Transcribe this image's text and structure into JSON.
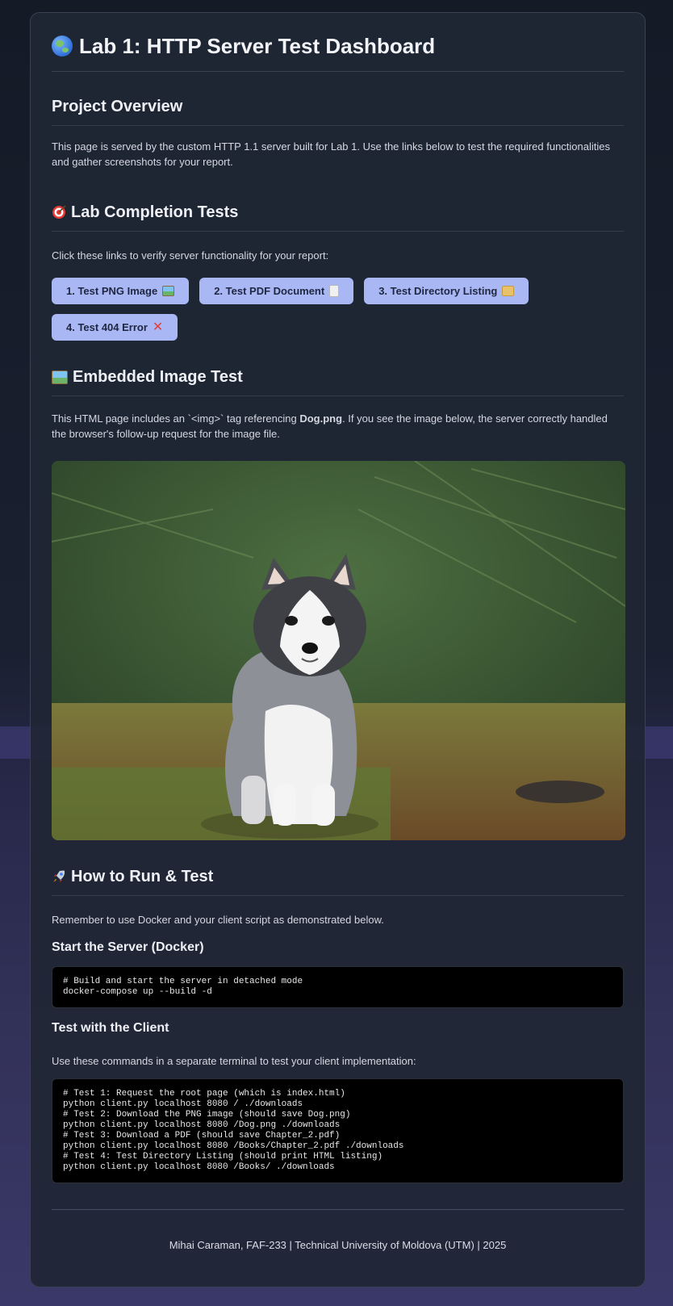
{
  "header": {
    "title": "Lab 1: HTTP Server Test Dashboard",
    "icon": "globe-icon"
  },
  "overview": {
    "heading": "Project Overview",
    "text": "This page is served by the custom HTTP 1.1 server built for Lab 1. Use the links below to test the required functionalities and gather screenshots for your report."
  },
  "tests": {
    "heading": "Lab Completion Tests",
    "icon": "target-icon",
    "intro": "Click these links to verify server functionality for your report:",
    "buttons": [
      {
        "label": "1. Test PNG Image",
        "icon": "image-icon"
      },
      {
        "label": "2. Test PDF Document",
        "icon": "document-icon"
      },
      {
        "label": "3. Test Directory Listing",
        "icon": "folder-icon"
      },
      {
        "label": "4. Test 404 Error",
        "icon": "x-icon"
      }
    ]
  },
  "embed": {
    "heading": "Embedded Image Test",
    "icon": "image-icon",
    "text_before": "This HTML page includes an `<img>` tag referencing ",
    "filename": "Dog.png",
    "text_after": ". If you see the image below, the server correctly handled the browser's follow-up request for the image file.",
    "image_subject": "husky puppy in pine forest"
  },
  "run": {
    "heading": "How to Run & Test",
    "icon": "rocket-icon",
    "intro": "Remember to use Docker and your client script as demonstrated below.",
    "server": {
      "heading": "Start the Server (Docker)",
      "code": [
        "# Build and start the server in detached mode",
        "docker-compose up --build -d"
      ]
    },
    "client": {
      "heading": "Test with the Client",
      "intro": "Use these commands in a separate terminal to test your client implementation:",
      "blocks": [
        [
          "# Test 1: Request the root page (which is index.html)",
          "python client.py localhost 8080 / ./downloads"
        ],
        [
          "# Test 2: Download the PNG image (should save Dog.png)",
          "python client.py localhost 8080 /Dog.png ./downloads"
        ],
        [
          "# Test 3: Download a PDF (should save Chapter_2.pdf)",
          "python client.py localhost 8080 /Books/Chapter_2.pdf ./downloads"
        ],
        [
          "# Test 4: Test Directory Listing (should print HTML listing)",
          "python client.py localhost 8080 /Books/ ./downloads"
        ]
      ]
    }
  },
  "footer": {
    "text": "Mihai Caraman, FAF-233 | Technical University of Moldova (UTM) | 2025"
  }
}
